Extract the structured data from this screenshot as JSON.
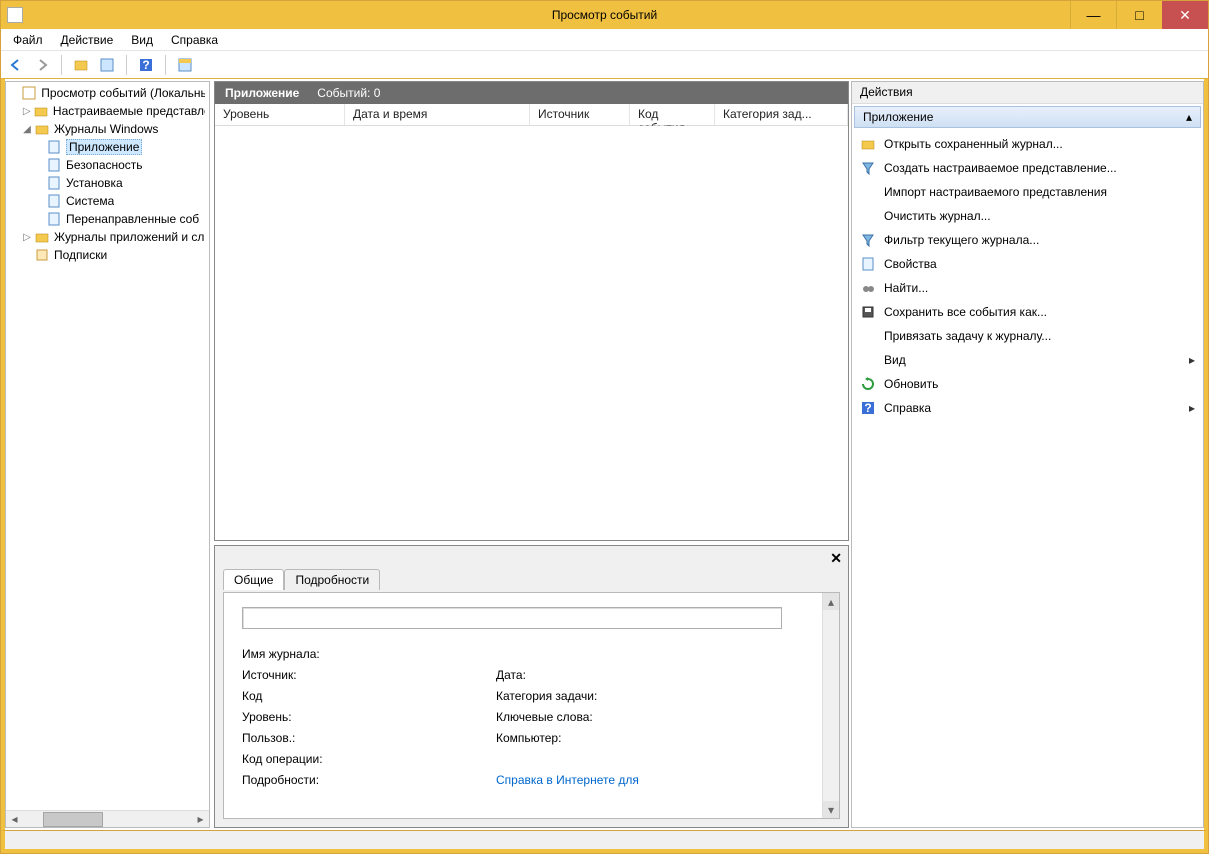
{
  "window": {
    "title": "Просмотр событий"
  },
  "menubar": {
    "file": "Файл",
    "action": "Действие",
    "view": "Вид",
    "help": "Справка"
  },
  "tree": {
    "root": "Просмотр событий (Локальны",
    "custom_views": "Настраиваемые представле",
    "windows_logs": "Журналы Windows",
    "app": "Приложение",
    "security": "Безопасность",
    "setup": "Установка",
    "system": "Система",
    "forwarded": "Перенаправленные соб",
    "app_logs": "Журналы приложений и сл",
    "subscriptions": "Подписки"
  },
  "center": {
    "header_name": "Приложение",
    "header_count": "Событий: 0",
    "columns": {
      "level": "Уровень",
      "datetime": "Дата и время",
      "source": "Источник",
      "code": "Код события",
      "category": "Категория зад..."
    }
  },
  "details": {
    "tab_general": "Общие",
    "tab_details": "Подробности",
    "log_name": "Имя журнала:",
    "source": "Источник:",
    "date": "Дата:",
    "code": "Код",
    "task_category": "Категория задачи:",
    "level": "Уровень:",
    "keywords": "Ключевые слова:",
    "user": "Пользов.:",
    "computer": "Компьютер:",
    "opcode": "Код операции:",
    "more_info": "Подробности:",
    "help_link": "Справка в Интернете для"
  },
  "actions": {
    "title": "Действия",
    "subtitle": "Приложение",
    "items": {
      "open_saved": "Открыть сохраненный журнал...",
      "create_view": "Создать настраиваемое представление...",
      "import_view": "Импорт настраиваемого представления",
      "clear_log": "Очистить журнал...",
      "filter_log": "Фильтр текущего журнала...",
      "properties": "Свойства",
      "find": "Найти...",
      "save_all": "Сохранить все события как...",
      "attach_task": "Привязать задачу к журналу...",
      "view": "Вид",
      "refresh": "Обновить",
      "help": "Справка"
    }
  }
}
